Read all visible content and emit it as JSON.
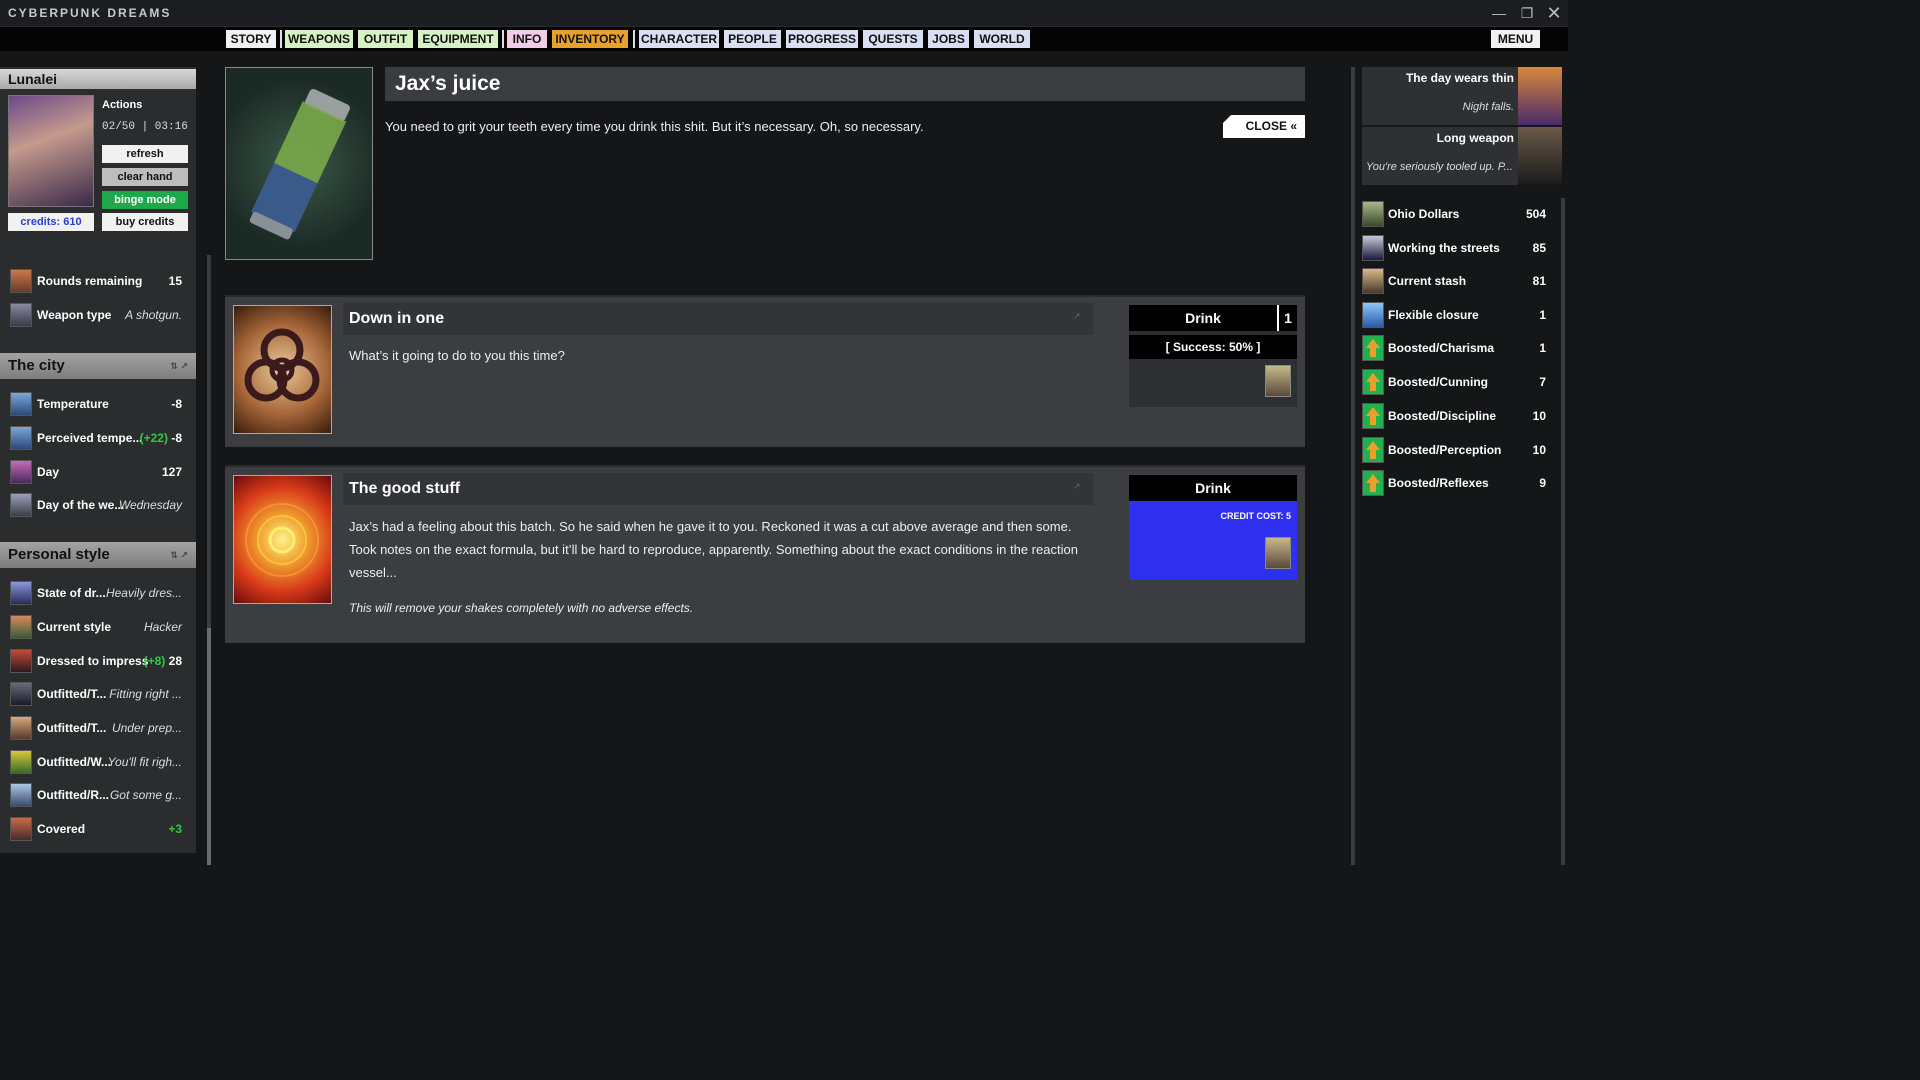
{
  "app": {
    "title": "CYBERPUNK DREAMS"
  },
  "nav": {
    "tabs": [
      {
        "label": "STORY",
        "color": "#f1f1f1"
      },
      {
        "label": "WEAPONS",
        "color": "#d6f2c4"
      },
      {
        "label": "OUTFIT",
        "color": "#d6f2c4"
      },
      {
        "label": "EQUIPMENT",
        "color": "#d6f2c4"
      },
      {
        "label": "INFO",
        "color": "#f3cde8"
      },
      {
        "label": "INVENTORY",
        "color": "#e8a12a"
      },
      {
        "label": "CHARACTER",
        "color": "#d8dff2"
      },
      {
        "label": "PEOPLE",
        "color": "#d8dff2"
      },
      {
        "label": "PROGRESS",
        "color": "#d8dff2"
      },
      {
        "label": "QUESTS",
        "color": "#d8dff2"
      },
      {
        "label": "JOBS",
        "color": "#d8dff2"
      },
      {
        "label": "WORLD",
        "color": "#d8dff2"
      }
    ],
    "menu_label": "MENU"
  },
  "player": {
    "name": "Lunalei",
    "actions_label": "Actions",
    "actions_value": "02/50 | 03:16",
    "credits": "credits: 610",
    "buttons": {
      "refresh": "refresh",
      "clear_hand": "clear hand",
      "binge_mode": "binge mode",
      "buy_credits": "buy credits"
    }
  },
  "weapon_stats": [
    {
      "label": "Rounds remaining",
      "value": "15"
    },
    {
      "label": "Weapon type",
      "value": "A shotgun."
    }
  ],
  "city": {
    "title": "The city",
    "rows": [
      {
        "label": "Temperature",
        "bonus": "",
        "value": "-8"
      },
      {
        "label": "Perceived tempe...",
        "bonus": "(+22)",
        "value": "-8"
      },
      {
        "label": "Day",
        "bonus": "",
        "value": "127"
      },
      {
        "label": "Day of the we...",
        "bonus": "",
        "value": "Wednesday"
      }
    ]
  },
  "style": {
    "title": "Personal style",
    "rows": [
      {
        "label": "State of dr...",
        "bonus": "",
        "value": "Heavily dres..."
      },
      {
        "label": "Current style",
        "bonus": "",
        "value": "Hacker"
      },
      {
        "label": "Dressed to impress",
        "bonus": "(+8)",
        "value": "28"
      },
      {
        "label": "Outfitted/T...",
        "bonus": "",
        "value": "Fitting right ..."
      },
      {
        "label": "Outfitted/T...",
        "bonus": "",
        "value": "Under prep..."
      },
      {
        "label": "Outfitted/W...",
        "bonus": "",
        "value": "You'll fit righ..."
      },
      {
        "label": "Outfitted/R...",
        "bonus": "",
        "value": "Got some g..."
      },
      {
        "label": "Covered",
        "bonus": "",
        "value": "+3"
      }
    ]
  },
  "item": {
    "title": "Jax’s juice",
    "description": "You need to grit your teeth every time you drink this shit. But it’s necessary. Oh, so necessary.",
    "close_label": "CLOSE «"
  },
  "actions": [
    {
      "title": "Down in one",
      "text": "What’s it going to do to you this time?",
      "button": "Drink",
      "count": "1",
      "success": "[ Success: 50% ]"
    },
    {
      "title": "The good stuff",
      "text": "Jax’s had a feeling about this batch. So he said when he gave it to you. Reckoned it was a cut above average and then some. Took notes on the exact formula, but it’ll be hard to reproduce, apparently. Something about the exact conditions in the reaction vessel...",
      "note": "This will remove your shakes completely with no adverse effects.",
      "button": "Drink",
      "cost": "CREDIT COST: 5"
    }
  ],
  "events": [
    {
      "title": "The day wears thin",
      "subtitle": "Night falls."
    },
    {
      "title": "Long weapon",
      "subtitle": "You're seriously tooled up. P..."
    }
  ],
  "resources": [
    {
      "label": "Ohio Dollars",
      "value": "504"
    },
    {
      "label": "Working the streets",
      "value": "85"
    },
    {
      "label": "Current stash",
      "value": "81"
    },
    {
      "label": "Flexible closure",
      "value": "1"
    },
    {
      "label": "Boosted/Charisma",
      "value": "1"
    },
    {
      "label": "Boosted/Cunning",
      "value": "7"
    },
    {
      "label": "Boosted/Discipline",
      "value": "10"
    },
    {
      "label": "Boosted/Perception",
      "value": "10"
    },
    {
      "label": "Boosted/Reflexes",
      "value": "9"
    }
  ],
  "colors": {
    "accent_green": "#22b14c",
    "binge_green": "#1fa84a",
    "credit_blue": "#2f2ff0",
    "inventory_orange": "#e8a12a",
    "credits_text": "#2a3fd6"
  }
}
